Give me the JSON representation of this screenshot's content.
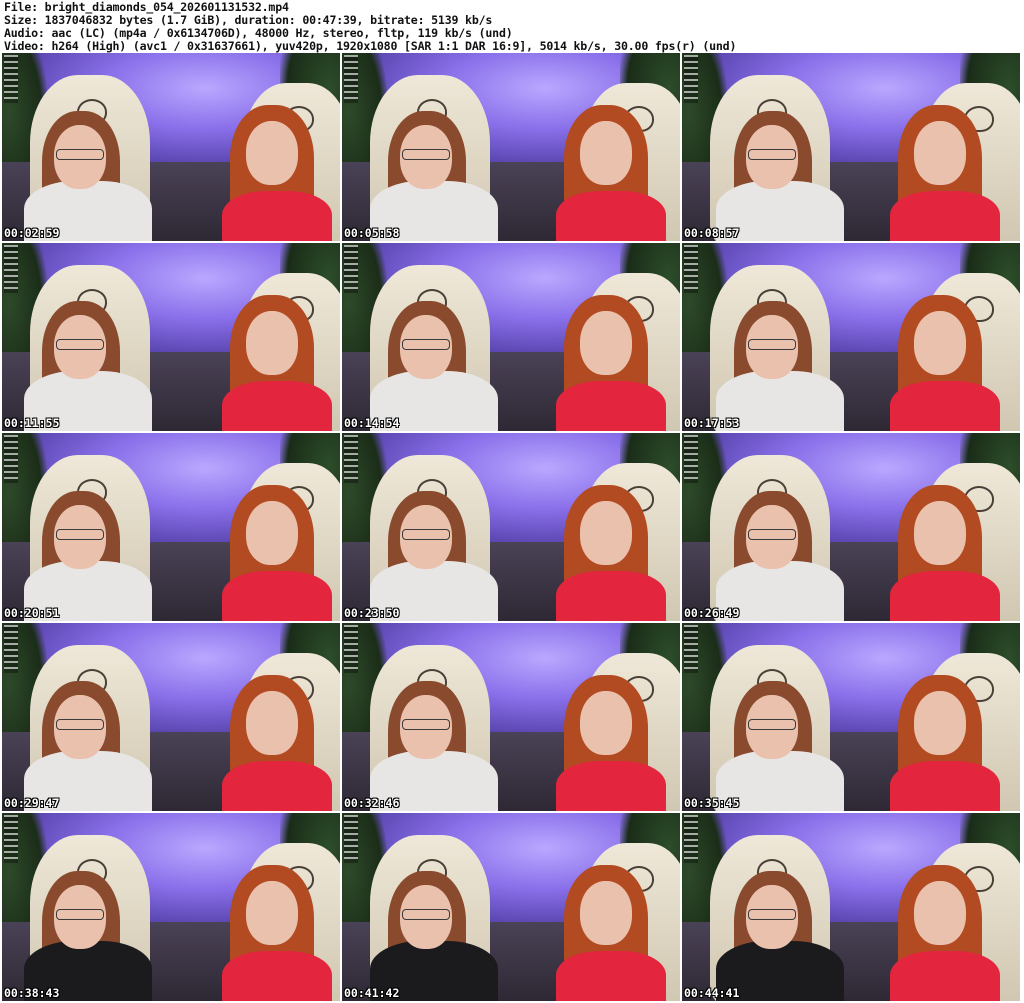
{
  "info": {
    "line1": "File: bright_diamonds_054_202601131532.mp4",
    "line2": "Size: 1837046832 bytes (1.7 GiB), duration: 00:47:39, bitrate: 5139 kb/s",
    "line3": "Audio: aac (LC) (mp4a / 0x6134706D), 48000 Hz, stereo, fltp, 119 kb/s (und)",
    "line4": "Video: h264 (High) (avc1 / 0x31637661), yuv420p, 1920x1080 [SAR 1:1 DAR 16:9], 5014 kb/s, 30.00 fps(r) (und)"
  },
  "thumbnails": [
    {
      "timestamp": "00:02:59",
      "top": "white",
      "right_top": "red"
    },
    {
      "timestamp": "00:05:58",
      "top": "white",
      "right_top": "red"
    },
    {
      "timestamp": "00:08:57",
      "top": "white",
      "right_top": "red"
    },
    {
      "timestamp": "00:11:55",
      "top": "white",
      "right_top": "red"
    },
    {
      "timestamp": "00:14:54",
      "top": "white",
      "right_top": "red"
    },
    {
      "timestamp": "00:17:53",
      "top": "white",
      "right_top": "red"
    },
    {
      "timestamp": "00:20:51",
      "top": "white",
      "right_top": "red"
    },
    {
      "timestamp": "00:23:50",
      "top": "white",
      "right_top": "red"
    },
    {
      "timestamp": "00:26:49",
      "top": "white",
      "right_top": "red"
    },
    {
      "timestamp": "00:29:47",
      "top": "white",
      "right_top": "red"
    },
    {
      "timestamp": "00:32:46",
      "top": "white",
      "right_top": "red"
    },
    {
      "timestamp": "00:35:45",
      "top": "white",
      "right_top": "red"
    },
    {
      "timestamp": "00:38:43",
      "top": "black",
      "right_top": "red"
    },
    {
      "timestamp": "00:41:42",
      "top": "black",
      "right_top": "red"
    },
    {
      "timestamp": "00:44:41",
      "top": "black",
      "right_top": "red"
    }
  ],
  "colors": {
    "white_top": "#e8e6e4",
    "black_top": "#1b1a1d",
    "red_top": "#e3253d",
    "left_hair": "#8a4a2e",
    "right_hair": "#b24a22"
  }
}
